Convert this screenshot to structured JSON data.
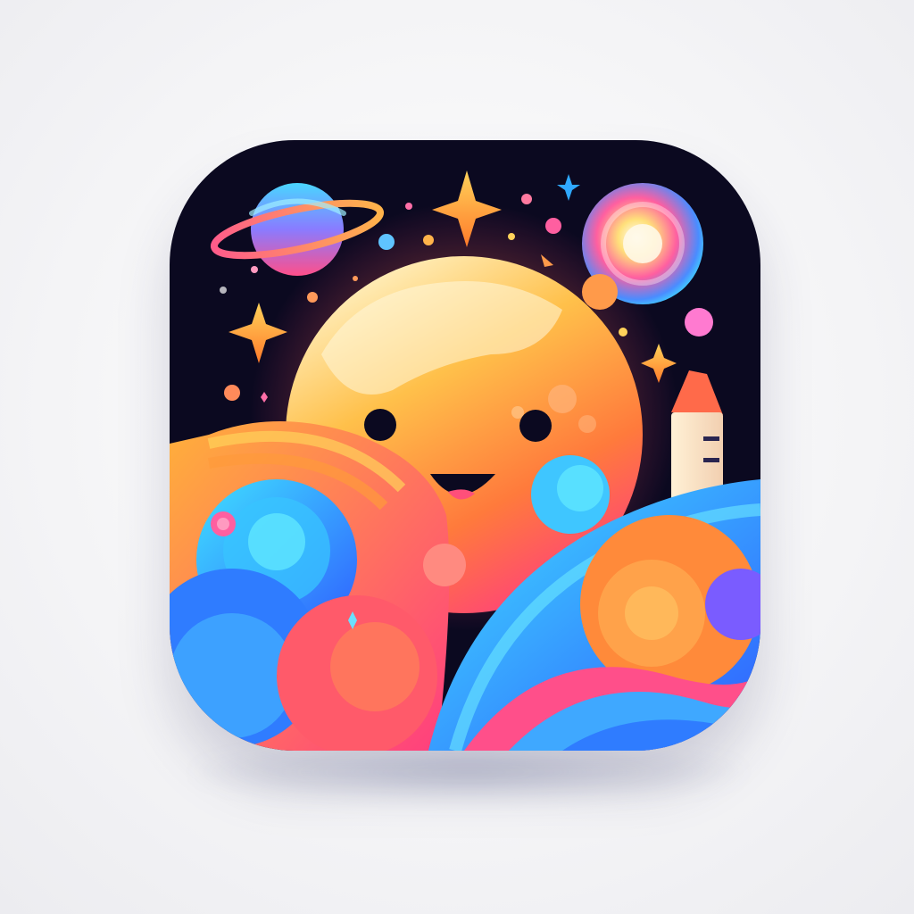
{
  "app_icon": {
    "subject": "smiling-planet-space-scene",
    "colors": {
      "frame": "#0b0920",
      "background": "#f2f2f4",
      "planet_top": "#fff4c8",
      "planet_mid": "#ffa53a",
      "planet_bottom": "#ff3d7f",
      "accent_blue": "#2f8cff",
      "accent_cyan": "#3fe0ff",
      "accent_pink": "#ff3d8a",
      "accent_orange": "#ff8a2a",
      "star_gold": "#ffb02e"
    },
    "icons": [
      "ringed-planet-icon",
      "sparkle-star-icon",
      "gradient-orb-icon",
      "smiling-planet-face-icon",
      "rocket-icon",
      "cloud-swirl-icon"
    ]
  }
}
